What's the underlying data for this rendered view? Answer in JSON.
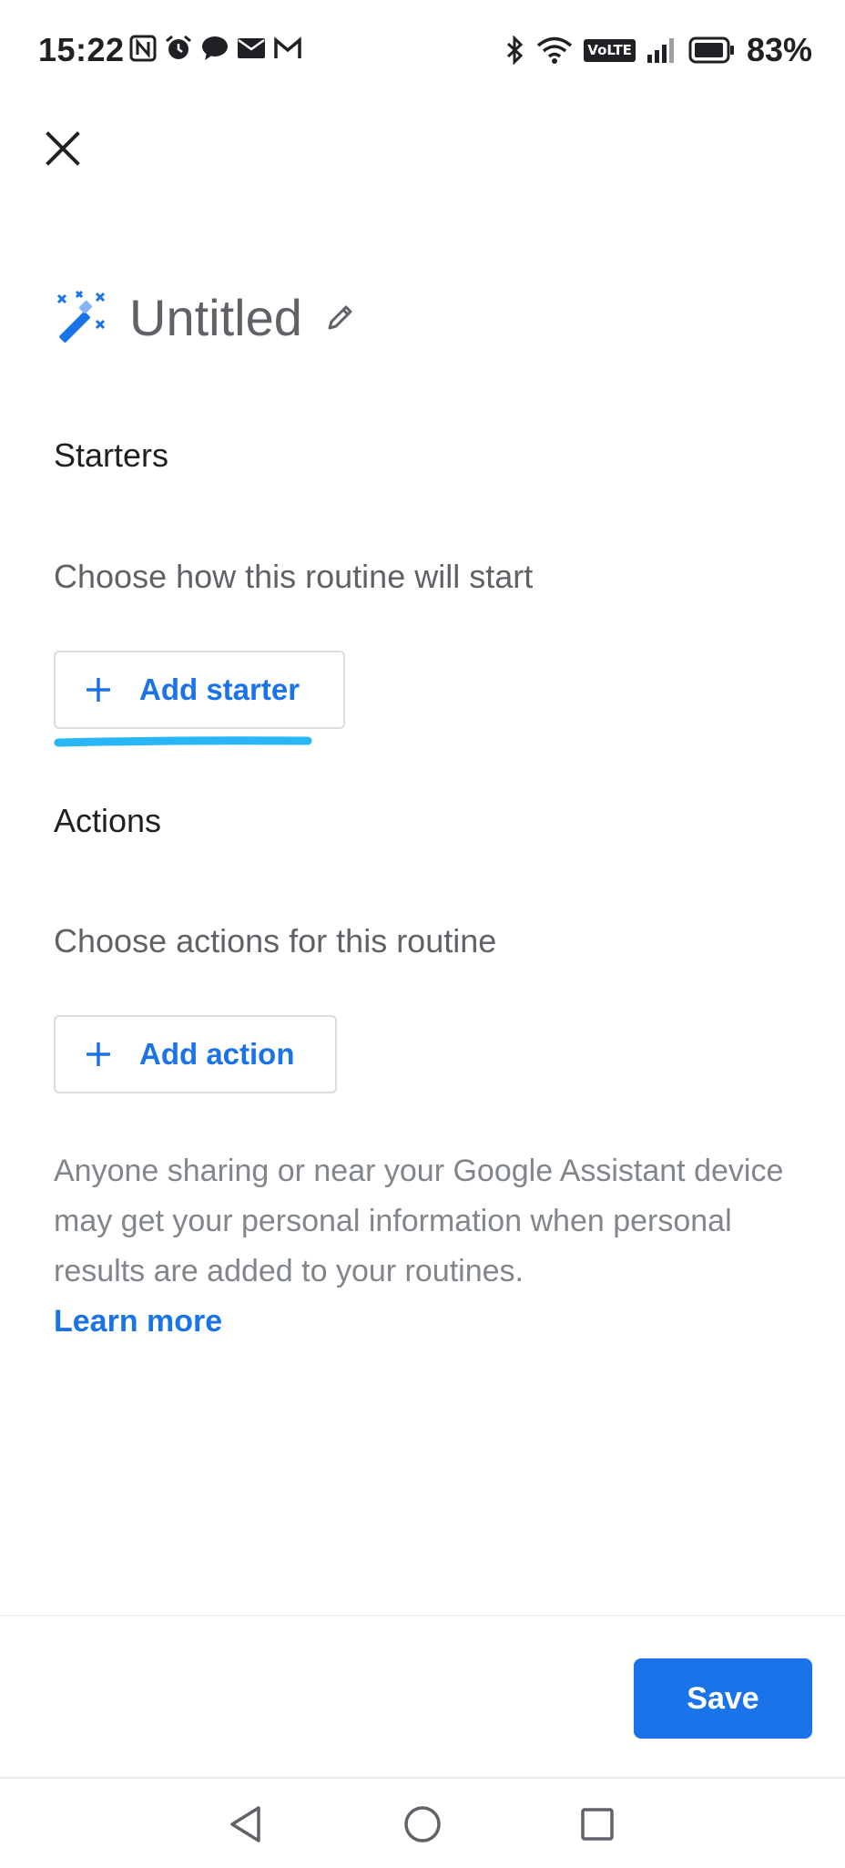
{
  "status_bar": {
    "time": "15:22",
    "battery": "83%",
    "network_badge": "VoLTE",
    "notification_icons": [
      "nfc-icon",
      "alarm-icon",
      "chat-icon",
      "email-icon",
      "gmail-icon"
    ],
    "system_icons": [
      "bluetooth-icon",
      "wifi-icon",
      "signal-icon",
      "battery-icon"
    ]
  },
  "header": {
    "close_icon": "close-icon"
  },
  "routine": {
    "title": "Untitled",
    "title_icon": "magic-wand-icon",
    "edit_icon": "pencil-icon"
  },
  "starters": {
    "heading": "Starters",
    "subtitle": "Choose how this routine will start",
    "add_label": "Add starter"
  },
  "actions": {
    "heading": "Actions",
    "subtitle": "Choose actions for this routine",
    "add_label": "Add action"
  },
  "disclaimer": {
    "text": "Anyone sharing or near your Google Assistant device may get your personal information when personal results are added to your routines.",
    "link": "Learn more"
  },
  "footer": {
    "save_label": "Save"
  },
  "colors": {
    "accent": "#1a73e8",
    "highlight": "#29b6f6",
    "muted_text": "#5f6368",
    "disclaimer_text": "#80868b",
    "outline": "#dadce0"
  }
}
